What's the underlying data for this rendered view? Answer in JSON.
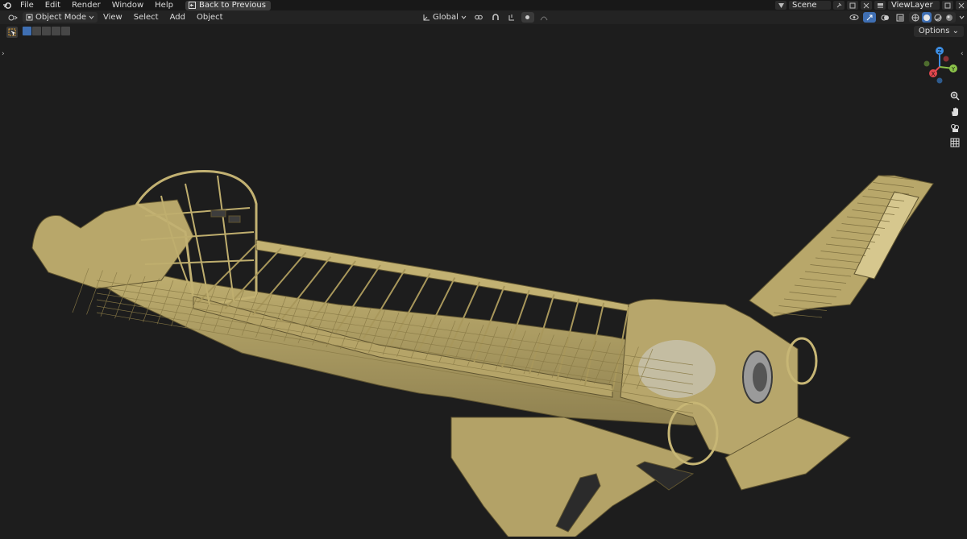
{
  "topbar": {
    "menu": [
      "File",
      "Edit",
      "Render",
      "Window",
      "Help"
    ],
    "back_button": "Back to Previous",
    "scene": "Scene",
    "view_layer": "ViewLayer"
  },
  "header": {
    "mode": "Object Mode",
    "menus": [
      "View",
      "Select",
      "Add",
      "Object"
    ],
    "transform_orientation": "Global",
    "options": "Options"
  },
  "gizmo": {
    "axes": [
      "Z",
      "Y",
      "X"
    ],
    "colors": {
      "x": "#e0464d",
      "y": "#8bc34a",
      "z": "#3c8de3"
    }
  },
  "viewport": {
    "model_color": "#bcaa6a",
    "background": "#1d1d1d"
  }
}
